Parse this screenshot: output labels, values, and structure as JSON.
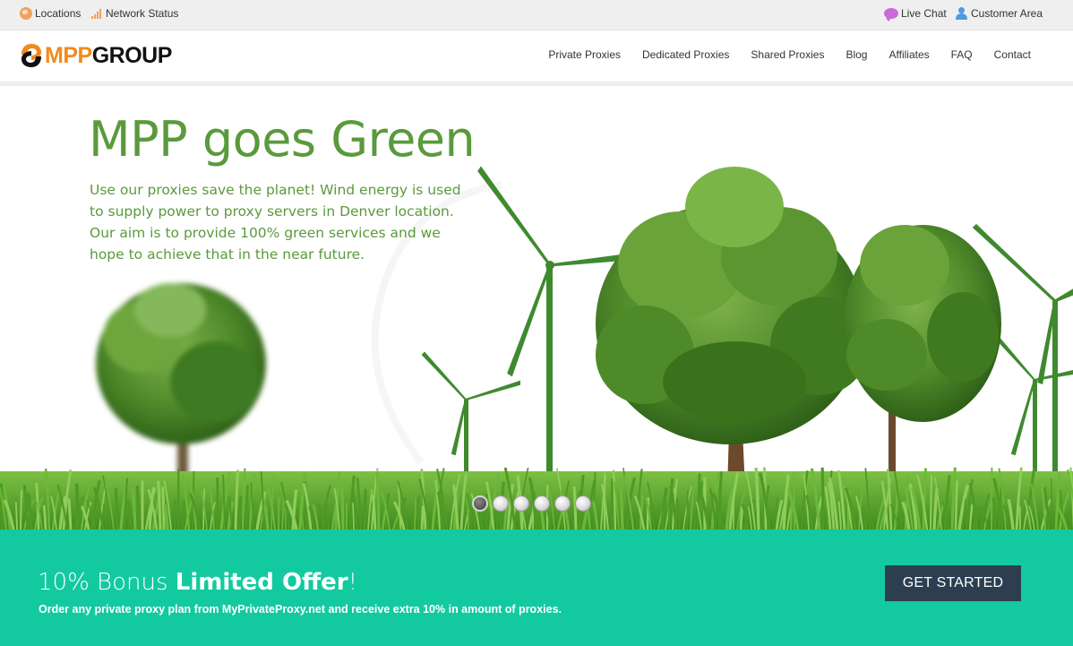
{
  "topbar": {
    "locations_label": "Locations",
    "network_status_label": "Network Status",
    "live_chat_label": "Live Chat",
    "customer_area_label": "Customer Area"
  },
  "brand": {
    "logo_part1": "MPP",
    "logo_part2": "GROUP",
    "accent_color": "#f18a1d"
  },
  "nav": {
    "items": [
      {
        "label": "Private Proxies"
      },
      {
        "label": "Dedicated Proxies"
      },
      {
        "label": "Shared Proxies"
      },
      {
        "label": "Blog"
      },
      {
        "label": "Affiliates"
      },
      {
        "label": "FAQ"
      },
      {
        "label": "Contact"
      }
    ]
  },
  "hero": {
    "title": "MPP goes Green",
    "description": "Use our proxies save the planet! Wind energy is used to supply power to proxy servers in Denver location. Our aim is to provide 100% green services and we hope to achieve that in the near future.",
    "text_color": "#5a9a3c",
    "slides_total": 6,
    "active_slide": 1
  },
  "offer": {
    "title_prefix": "10% Bonus ",
    "title_bold": "Limited Offer",
    "title_suffix": "!",
    "subtitle": "Order any private proxy plan from MyPrivateProxy.net and receive extra 10% in amount of proxies.",
    "cta_label": "GET STARTED",
    "band_color": "#13c9a0",
    "cta_color": "#2c3e50"
  }
}
